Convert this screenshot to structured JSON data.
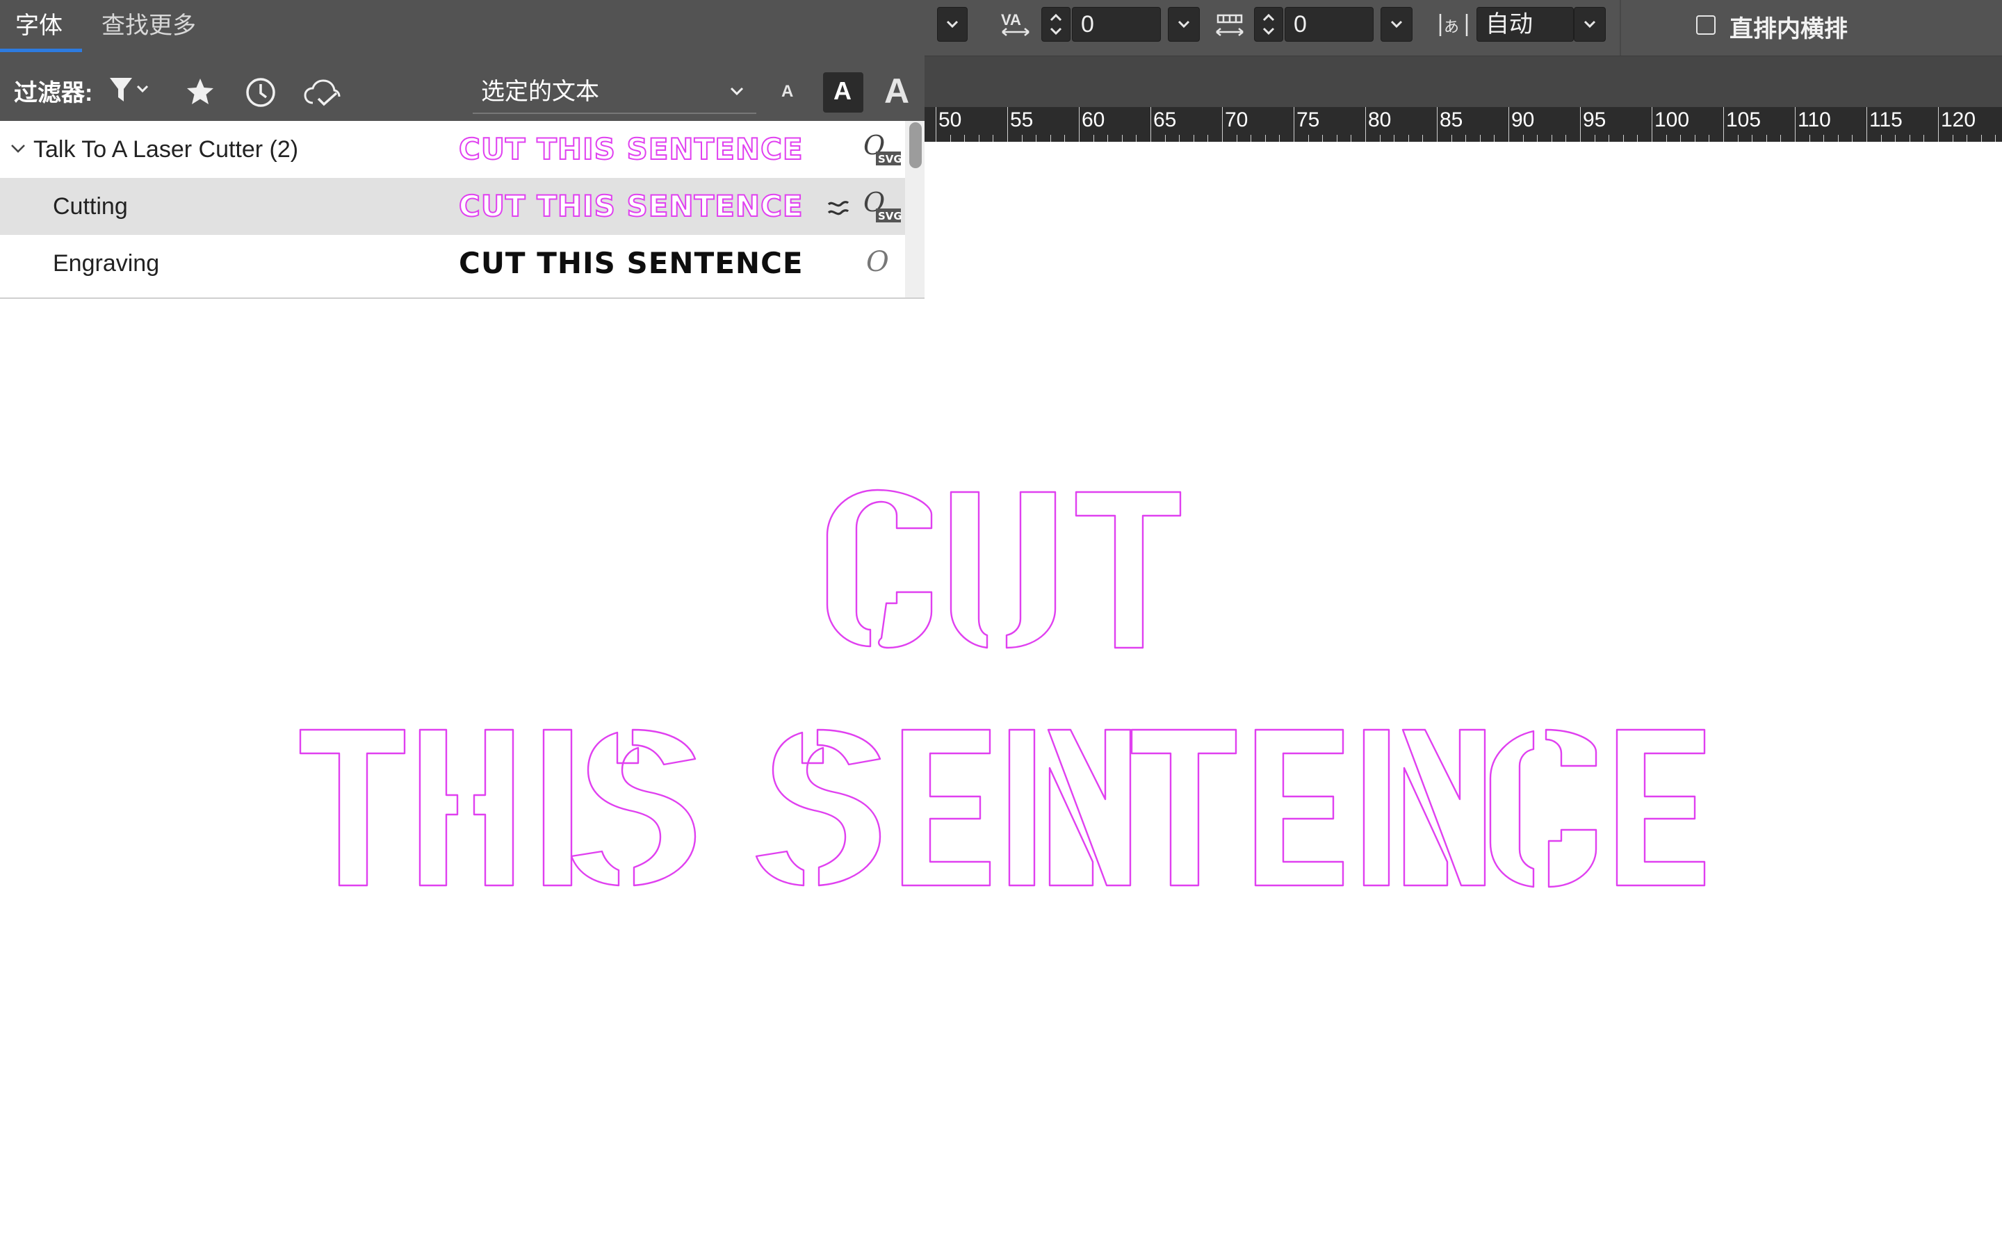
{
  "panel": {
    "tabs": [
      {
        "label": "字体"
      },
      {
        "label": "查找更多"
      }
    ],
    "filter_label": "过滤器:",
    "filter_icons": [
      "filter-icon",
      "star-icon",
      "clock-icon",
      "cloud-check-icon"
    ],
    "scope_value": "选定的文本",
    "size_buttons": [
      "A",
      "A",
      "A"
    ],
    "families": [
      {
        "name": "Talk To A Laser Cutter (2)",
        "expanded": true,
        "preview": "CUT THIS SENTENCE",
        "format_icon": "opentype-svg-icon",
        "styles": [
          {
            "name": "Cutting",
            "preview": "CUT THIS SENTENCE",
            "selected": true,
            "similar_icon": "approx-icon",
            "format_icon": "opentype-svg-icon"
          },
          {
            "name": "Engraving",
            "preview": "CUT THIS SENTENCE",
            "selected": false,
            "format_icon": "opentype-icon"
          }
        ]
      }
    ]
  },
  "control_bar": {
    "kerning_value": "0",
    "tracking_value": "0",
    "mojikumi_value": "自动",
    "checkbox_label": "直排内横排",
    "checkbox_checked": false
  },
  "ruler": {
    "labels": [
      "50",
      "55",
      "60",
      "65",
      "70",
      "75",
      "80",
      "85",
      "90",
      "95",
      "100",
      "105",
      "110",
      "115",
      "120"
    ]
  },
  "canvas": {
    "line1": "CUT",
    "line2": "THIS SENTENCE",
    "stroke_color": "#e040f0"
  },
  "colors": {
    "panel_dark": "#535353",
    "accent_blue": "#2d7be0",
    "magenta_outline": "#e040f0",
    "selected_row": "#e1e1e1"
  }
}
